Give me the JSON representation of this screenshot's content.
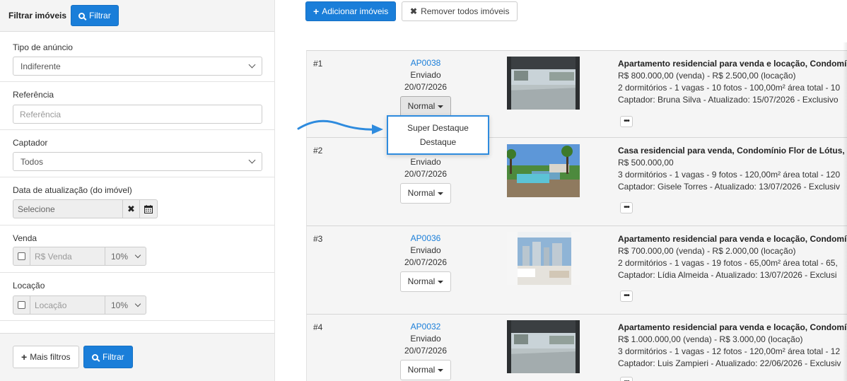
{
  "sidebar": {
    "title": "Filtrar imóveis",
    "header_filter_label": "Filtrar",
    "tipo": {
      "label": "Tipo de anúncio",
      "value": "Indiferente"
    },
    "referencia": {
      "label": "Referência",
      "placeholder": "Referência"
    },
    "captador": {
      "label": "Captador",
      "value": "Todos"
    },
    "data_atualizacao": {
      "label": "Data de atualização (do imóvel)",
      "placeholder": "Selecione",
      "clear_icon": "✖",
      "calendar_icon": "calendar-icon"
    },
    "venda": {
      "label": "Venda",
      "placeholder": "R$ Venda",
      "percent": "10%"
    },
    "locacao": {
      "label": "Locação",
      "placeholder": "Locação",
      "percent": "10%"
    },
    "footer": {
      "more_filters": "Mais filtros",
      "filter": "Filtrar"
    }
  },
  "toolbar": {
    "add_label": "Adicionar imóveis",
    "remove_label": "Remover todos imóveis"
  },
  "listings": [
    {
      "num": "#1",
      "ref": "AP0038",
      "status": "Enviado",
      "date": "20/07/2026",
      "priority": "Normal",
      "title": "Apartamento residencial para venda e locação, Condomínio",
      "price": "R$ 800.000,00 (venda) - R$ 2.500,00 (locação)",
      "specs": "2 dormitórios - 1 vagas - 10 fotos - 100,00m² área total - 10",
      "captador": "Captador: Bruna Silva - Atualizado: 15/07/2026 - Exclusivo"
    },
    {
      "num": "#2",
      "ref": "",
      "status": "Enviado",
      "date": "20/07/2026",
      "priority": "Normal",
      "title": "Casa residencial para venda, Condomínio Flor de Lótus, Cer",
      "price": "R$ 500.000,00",
      "specs": "3 dormitórios - 1 vagas - 9 fotos - 120,00m² área total - 120",
      "captador": "Captador: Gisele Torres - Atualizado: 13/07/2026 - Exclusiv"
    },
    {
      "num": "#3",
      "ref": "AP0036",
      "status": "Enviado",
      "date": "20/07/2026",
      "priority": "Normal",
      "title": "Apartamento residencial para venda e locação, Condomínio",
      "price": "R$ 700.000,00 (venda) - R$ 2.000,00 (locação)",
      "specs": "2 dormitórios - 1 vagas - 19 fotos - 65,00m² área total - 65,",
      "captador": "Captador: Lídia Almeida - Atualizado: 13/07/2026 - Exclusi"
    },
    {
      "num": "#4",
      "ref": "AP0032",
      "status": "Enviado",
      "date": "20/07/2026",
      "priority": "Normal",
      "title": "Apartamento residencial para venda e locação, Condomínio",
      "price": "R$ 1.000.000,00 (venda) - R$ 3.000,00 (locação)",
      "specs": "3 dormitórios - 1 vagas - 12 fotos - 120,00m² área total - 12",
      "captador": "Captador: Luis Zampieri - Atualizado: 22/06/2026 - Exclusiv"
    }
  ],
  "dropdown_menu": {
    "items": [
      "Super Destaque",
      "Destaque"
    ]
  },
  "more_label": "•••",
  "colors": {
    "primary": "#1a7ed9",
    "highlight_border": "#2e8bde"
  }
}
